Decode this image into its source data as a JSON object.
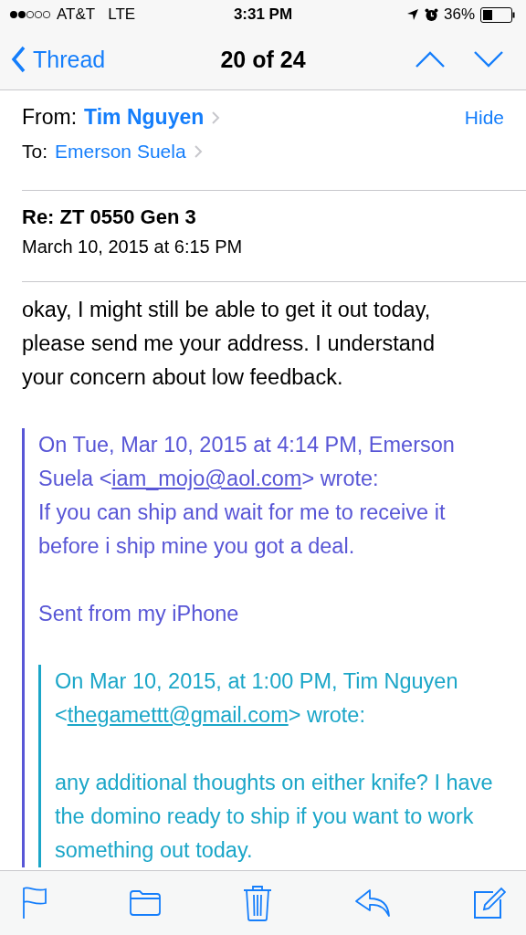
{
  "status_bar": {
    "carrier": "AT&T",
    "network": "LTE",
    "time": "3:31 PM",
    "battery": "36%"
  },
  "nav": {
    "back": "Thread",
    "title": "20 of 24"
  },
  "header": {
    "from_label": "From:",
    "from": "Tim Nguyen",
    "hide": "Hide",
    "to_label": "To:",
    "to": "Emerson Suela"
  },
  "subject": "Re: ZT 0550 Gen 3",
  "date": "March 10, 2015 at 6:15 PM",
  "body": "okay, I might still be able to get it out today, please send me your address. I understand your concern about low feedback.",
  "quote": {
    "color": "#5856d6",
    "blank_after_attribution": false,
    "attribution_before": "On Tue, Mar 10, 2015 at 4:14 PM, Emerson Suela <",
    "email": "iam_mojo@aol.com",
    "attribution_after": "> wrote:",
    "paragraphs": [
      "If you can ship and wait for me to receive it before i ship mine you got a deal.",
      "Sent from my iPhone"
    ],
    "children": [
      {
        "color": "#1ba6c8",
        "blank_after_attribution": true,
        "attribution_before": "On Mar 10, 2015, at 1:00 PM, Tim Nguyen <",
        "email": "thegamettt@gmail.com",
        "attribution_after": "> wrote:",
        "paragraphs": [
          "any additional thoughts on either knife? I have the domino ready to ship if you want to work something out today."
        ]
      }
    ]
  }
}
